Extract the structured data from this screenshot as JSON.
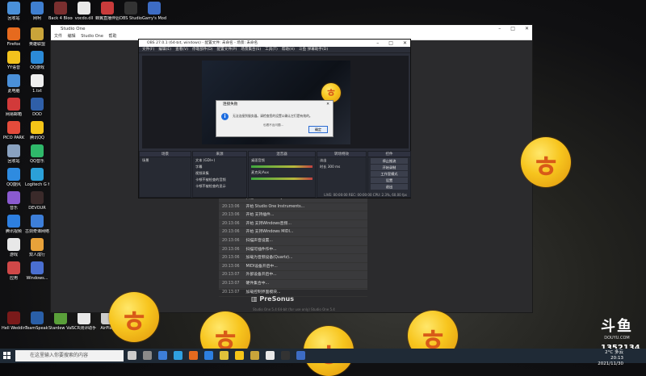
{
  "desktop_icons": [
    {
      "label": "回收站",
      "color": "#4a90d9"
    },
    {
      "label": "网柯",
      "color": "#3f7fd0"
    },
    {
      "label": "Back 4 Blood Beta",
      "color": "#7a2f2f"
    },
    {
      "label": "vocdo.dll",
      "color": "#e8e8e8"
    },
    {
      "label": "蝉翼直播伴侣专 播出...",
      "color": "#c93b3b"
    },
    {
      "label": "OBS Studio",
      "color": "#333333"
    },
    {
      "label": "Garry's Mod",
      "color": "#3d6cc4"
    },
    {
      "label": "Firefox",
      "color": "#e66a1e"
    },
    {
      "label": "英雄联盟",
      "color": "#c9a43a"
    },
    {
      "label": "YY语音",
      "color": "#f2c21d"
    },
    {
      "label": "QQ游戏",
      "color": "#2b8ad8"
    },
    {
      "label": "此电脑",
      "color": "#4a90d9"
    },
    {
      "label": "1.txt",
      "color": "#eeeeee"
    },
    {
      "label": "网易邮箱",
      "color": "#d23a3a"
    },
    {
      "label": "DOD",
      "color": "#2f5fa8"
    },
    {
      "label": "PICO PARK",
      "color": "#e44b3b"
    },
    {
      "label": "腾讯QQ",
      "color": "#f5c518"
    },
    {
      "label": "回收站",
      "color": "#8aa2c0"
    },
    {
      "label": "QQ音乐",
      "color": "#2fb86a"
    },
    {
      "label": "QQ旋风",
      "color": "#2e8be0"
    },
    {
      "label": "Logitech G HUB",
      "color": "#2ba0d8"
    },
    {
      "label": "音乐",
      "color": "#8a5ad0"
    },
    {
      "label": "DEVOUR",
      "color": "#3a2a2a"
    },
    {
      "label": "腾讯视频",
      "color": "#2d7fe0"
    },
    {
      "label": "古剑奇谭网络版",
      "color": "#3d7ed8"
    },
    {
      "label": "游戏",
      "color": "#e8e8e8"
    },
    {
      "label": "双人成行",
      "color": "#e8a23a"
    },
    {
      "label": "应用",
      "color": "#d04848"
    },
    {
      "label": "Windows...",
      "color": "#4a6fd0"
    },
    {
      "label": "Hell Wedding...",
      "color": "#7a1a1a"
    },
    {
      "label": "TeamSpeak 3",
      "color": "#2a5fa8"
    },
    {
      "label": "Stardew Valley",
      "color": "#5aa03a"
    },
    {
      "label": "SCR测评助手",
      "color": "#e8e8e8"
    },
    {
      "label": "AirPlay",
      "color": "#cccccc"
    }
  ],
  "studio_one": {
    "title": "Studio One",
    "menu": [
      "文件",
      "编辑",
      "Studio One",
      "帮助"
    ],
    "log": [
      {
        "time": "20:13:06",
        "text": "扫描 Studio One Hybrid FX Pack..."
      },
      {
        "time": "20:13:06",
        "text": "开始 Studio One Instruments..."
      },
      {
        "time": "20:13:06",
        "text": "开始 支持插件..."
      },
      {
        "time": "20:13:06",
        "text": "开始 支持Windows音频..."
      },
      {
        "time": "20:13:06",
        "text": "开始 支持Windows MIDI..."
      },
      {
        "time": "20:13:06",
        "text": "扫描声音设置..."
      },
      {
        "time": "20:13:06",
        "text": "扫描可插件作中..."
      },
      {
        "time": "20:13:06",
        "text": "加载为音频设备(Quartz)..."
      },
      {
        "time": "20:13:06",
        "text": "MIDI设备开启中..."
      },
      {
        "time": "20:13:07",
        "text": "外部设备开启中..."
      },
      {
        "time": "20:13:07",
        "text": "硬件集合中..."
      },
      {
        "time": "20:13:07",
        "text": "加载控制界面模块..."
      }
    ],
    "brand": "PreSonus",
    "footer": "Studio One 5.4 64-bit (for use only) Studio One 5.4"
  },
  "obs": {
    "title": "OBS 27.0.1 (64-bit, windows) - 配置文件: 未命名 - 场景: 未命名",
    "menu": [
      "文件(F)",
      "编辑(E)",
      "查看(V)",
      "停靠部件(D)",
      "配置文件(P)",
      "场景集合(S)",
      "工具(T)",
      "帮助(H)",
      "斗鱼 弹幕助手(D)"
    ],
    "dialog": {
      "title": "连接失败",
      "message": "无法连接到服务器。请检查您的设置以确认它们是有效的。",
      "sub": "也看不出问题...",
      "button": "确定"
    },
    "docks": {
      "scenes": {
        "header": "场景",
        "items": [
          "场景"
        ]
      },
      "sources": {
        "header": "来源",
        "items": [
          "文本 (GDI+)",
          "字幕",
          "视频采集",
          "卡顿不被检查的音频",
          "卡顿不被检查的显示"
        ]
      },
      "mixer": {
        "header": "混音器",
        "items": [
          "桌面音频",
          "麦克风/Aux"
        ]
      },
      "transitions": {
        "header": "转场特效",
        "fade": "淡出",
        "duration_label": "时长",
        "duration": "300 ms"
      },
      "controls": {
        "header": "控件",
        "buttons": [
          "停止推流",
          "开始录制",
          "工作室模式",
          "设置",
          "退出"
        ]
      }
    },
    "status": "LIVE: 00:00:00   REC: 00:00:00   CPU: 2.3%, 60.00 fps"
  },
  "taskbar": {
    "search_placeholder": "在这里输入你要搜索的内容",
    "tray_temp": "2°C 多云",
    "time": "20:13",
    "date": "2021/11/30"
  },
  "overlay": {
    "douyu_logo": "斗鱼",
    "douyu_url": "DOUYU.COM",
    "room_id": "1352134"
  },
  "colors": {
    "sticker_fill": "#f7c51e",
    "sticker_glyph": "#d85a18",
    "taskbar": "#1f2a36"
  }
}
